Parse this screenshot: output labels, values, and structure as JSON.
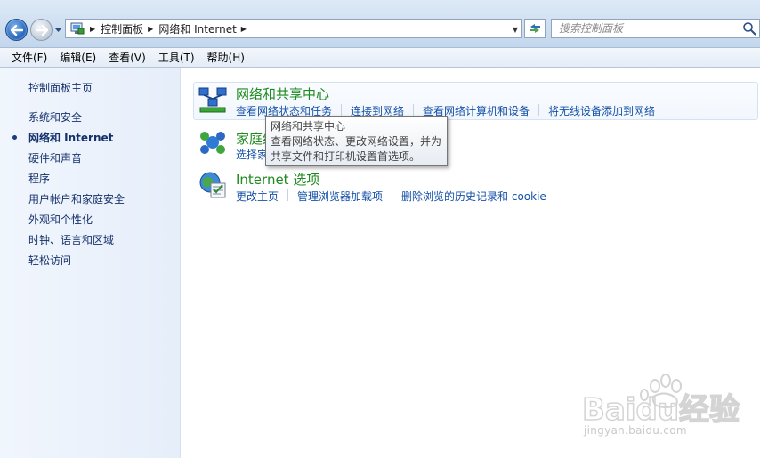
{
  "address_bar": {
    "breadcrumbs": [
      "控制面板",
      "网络和 Internet"
    ]
  },
  "search": {
    "placeholder": "搜索控制面板"
  },
  "menu": [
    "文件(F)",
    "编辑(E)",
    "查看(V)",
    "工具(T)",
    "帮助(H)"
  ],
  "sidebar": {
    "home": "控制面板主页",
    "items": [
      "系统和安全",
      "网络和 Internet",
      "硬件和声音",
      "程序",
      "用户帐户和家庭安全",
      "外观和个性化",
      "时钟、语言和区域",
      "轻松访问"
    ],
    "current_index": 1
  },
  "categories": [
    {
      "title": "网络和共享中心",
      "links": [
        "查看网络状态和任务",
        "连接到网络",
        "查看网络计算机和设备",
        "将无线设备添加到网络"
      ]
    },
    {
      "title": "家庭组",
      "links": [
        "选择家庭组和共享选项"
      ]
    },
    {
      "title": "Internet 选项",
      "links": [
        "更改主页",
        "管理浏览器加载项",
        "删除浏览的历史记录和 cookie"
      ]
    }
  ],
  "tooltip": {
    "title": "网络和共享中心",
    "line1": "查看网络状态、更改网络设置，并为",
    "line2": "共享文件和打印机设置首选项。"
  },
  "watermark": {
    "brand": "Baidu经验",
    "url": "jingyan.baidu.com"
  },
  "colors": {
    "category_title": "#1f8a1f",
    "link": "#1551a7",
    "sidebar_link": "#15316b"
  }
}
